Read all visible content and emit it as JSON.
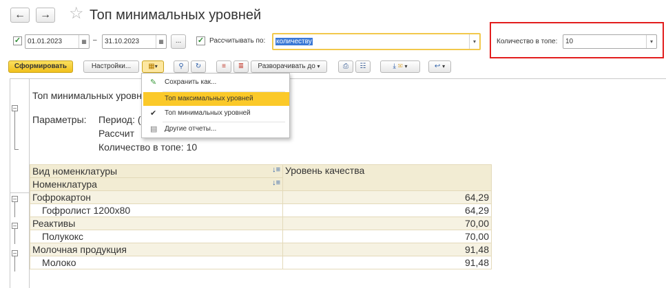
{
  "window": {
    "title": "Топ минимальных уровней"
  },
  "params": {
    "date_from": "01.01.2023",
    "date_dash": "–",
    "date_to": "31.10.2023",
    "period_picker_label": "...",
    "calc_by_label": "Рассчитывать по:",
    "calc_by_value": "количеству",
    "top_count_label": "Количество в топе:",
    "top_count_value": "10"
  },
  "toolbar": {
    "generate_label": "Сформировать",
    "settings_label": "Настройки...",
    "expand_label": "Разворачивать до"
  },
  "menu": {
    "items": [
      {
        "label": "Сохранить как..."
      },
      {
        "label": "Топ максимальных уровней"
      },
      {
        "label": "Топ минимальных уровней"
      },
      {
        "label": "Другие отчеты..."
      }
    ]
  },
  "report": {
    "title": "Топ минимальных уровн",
    "params_label": "Параметры:",
    "param_period": "Период: (",
    "param_calc": "Рассчит",
    "param_top": "Количество в топе: 10",
    "columns": {
      "type": "Вид номенклатуры",
      "nomenclature": "Номенклатура",
      "quality": "Уровень качества"
    },
    "groups": [
      {
        "name": "Гофрокартон",
        "value": "64,29",
        "item": "Гофролист 1200х80",
        "item_value": "64,29"
      },
      {
        "name": "Реактивы",
        "value": "70,00",
        "item": "Полукокс",
        "item_value": "70,00"
      },
      {
        "name": "Молочная продукция",
        "value": "91,48",
        "item": "Молоко",
        "item_value": "91,48"
      }
    ]
  },
  "colors": {
    "primary_button": "#f1c01c",
    "header_fill": "#f2ecd3",
    "menu_highlight": "#fbc929",
    "highlight_frame": "#e21c1c"
  }
}
